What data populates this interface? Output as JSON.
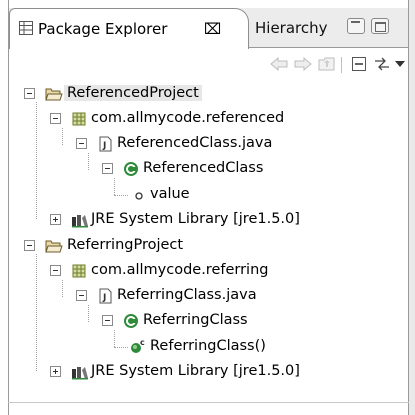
{
  "tabs": {
    "active_label": "Package Explorer",
    "active_close": "⌧",
    "inactive_label": "Hierarchy"
  },
  "toolbar": {
    "icons": [
      "back-icon",
      "forward-icon",
      "up-icon",
      "collapse-all-icon",
      "link-with-editor-icon",
      "view-menu-icon"
    ]
  },
  "tree": {
    "project1": {
      "label": "ReferencedProject",
      "expanded": true,
      "selected": true
    },
    "package1": {
      "label": "com.allmycode.referenced",
      "expanded": true
    },
    "file1": {
      "label": "ReferencedClass.java",
      "expanded": true
    },
    "class1": {
      "label": "ReferencedClass",
      "expanded": true
    },
    "field1": {
      "label": "value"
    },
    "lib1": {
      "label": "JRE System Library [jre1.5.0]",
      "expanded": false
    },
    "project2": {
      "label": "ReferringProject",
      "expanded": true
    },
    "package2": {
      "label": "com.allmycode.referring",
      "expanded": true
    },
    "file2": {
      "label": "ReferringClass.java",
      "expanded": true
    },
    "class2": {
      "label": "ReferringClass",
      "expanded": true
    },
    "constructor2": {
      "label": "ReferringClass()"
    },
    "lib2": {
      "label": "JRE System Library [jre1.5.0]",
      "expanded": false
    }
  },
  "colors": {
    "class_icon": "#2f8a3a",
    "package_icon": "#6b7d2a",
    "folder": "#c9b27a",
    "selection": "#e7e7e7"
  }
}
